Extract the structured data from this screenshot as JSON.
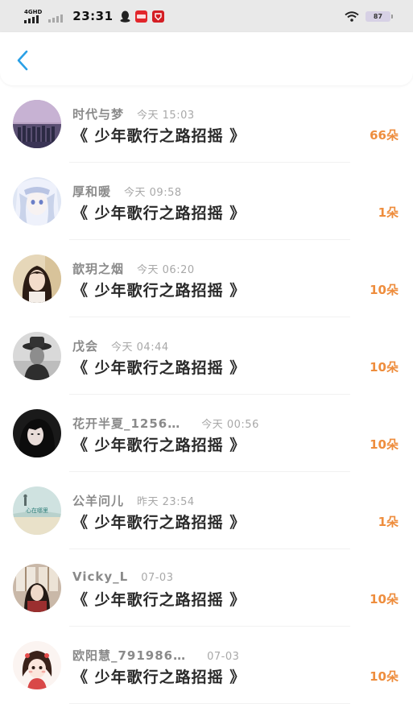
{
  "statusbar": {
    "network": "4GHD",
    "time": "23:31",
    "battery": "87",
    "icons": [
      "signal-icon",
      "signal-icon-2",
      "qq-penguin-icon",
      "red-app-icon",
      "red-app-icon-2",
      "wifi-icon",
      "battery-icon"
    ]
  },
  "navbar": {
    "back_icon": "chevron-left-icon",
    "accent": "#2aa0e6"
  },
  "colors": {
    "count": "#ee8d3d",
    "gift_text": "#2a2a2a",
    "name": "#8a8a8a"
  },
  "records": [
    {
      "name": "时代与梦",
      "time": "今天 15:03",
      "gift": "《 少年歌行之路招摇 》",
      "count": "66朵",
      "avatar": "crowd-photo"
    },
    {
      "name": "厚和暖",
      "time": "今天 09:58",
      "gift": "《 少年歌行之路招摇 》",
      "count": "1朵",
      "avatar": "anime-girl"
    },
    {
      "name": "歆玥之烟",
      "time": "今天 06:20",
      "gift": "《 少年歌行之路招摇 》",
      "count": "10朵",
      "avatar": "girl-portrait"
    },
    {
      "name": "戊会",
      "time": "今天 04:44",
      "gift": "《 少年歌行之路招摇 》",
      "count": "10朵",
      "avatar": "bw-hat-portrait"
    },
    {
      "name": "花开半夏_1256…",
      "time": "今天 00:56",
      "gift": "《 少年歌行之路招摇 》",
      "count": "10朵",
      "avatar": "dark-girl"
    },
    {
      "name": "公羊问儿",
      "time": "昨天 23:54",
      "gift": "《 少年歌行之路招摇 》",
      "count": "1朵",
      "avatar": "text-sky",
      "avatar_text": "心在哪里"
    },
    {
      "name": "Vicky_L",
      "time": "07-03",
      "gift": "《 少年歌行之路招摇 》",
      "count": "10朵",
      "avatar": "window-girl"
    },
    {
      "name": "欧阳慧_791986…",
      "time": "07-03",
      "gift": "《 少年歌行之路招摇 》",
      "count": "10朵",
      "avatar": "cartoon-girl"
    }
  ]
}
